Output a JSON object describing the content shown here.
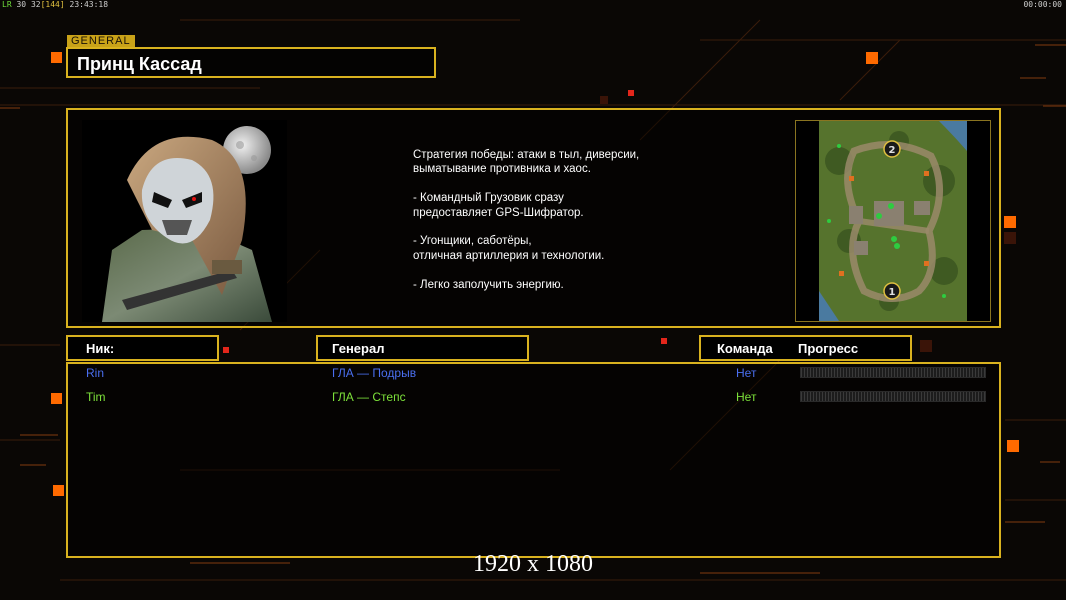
{
  "hud": {
    "left_prefix": "LR",
    "left_num1": "30",
    "left_num2": "32",
    "left_bracket": "[144]",
    "left_time": "23:43:18",
    "right_time": "00:00:00"
  },
  "general_tag": "GENERAL",
  "general_name": "Принц Кассад",
  "strategy": {
    "p1": "Стратегия победы: атаки в тыл, диверсии,\n выматывание противника и хаос.",
    "p2": "- Командный Грузовик сразу\nпредоставляет GPS-Шифратор.",
    "p3": "- Угонщики, саботёры,\nотличная артиллерия и технологии.",
    "p4": "- Легко заполучить энергию."
  },
  "minimap": {
    "markers": [
      "1",
      "2"
    ]
  },
  "headers": {
    "nick": "Ник:",
    "general": "Генерал",
    "team": "Команда",
    "progress": "Прогресс"
  },
  "players": [
    {
      "nick": "Rin",
      "general": "ГЛА — Подрыв",
      "team": "Нет",
      "color": "#4a6ff0",
      "progress": 0
    },
    {
      "nick": "Tim",
      "general": "ГЛА — Степс",
      "team": "Нет",
      "color": "#7ce03a",
      "progress": 0
    }
  ],
  "resolution_label": "1920 x 1080",
  "colors": {
    "accent": "#d9b21f",
    "accent_orange": "#ff6a00",
    "background": "#0a0705"
  }
}
